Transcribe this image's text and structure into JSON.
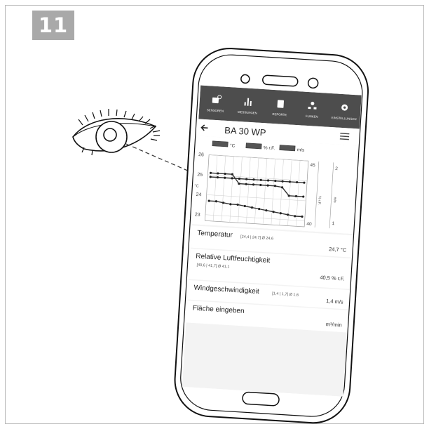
{
  "step_number": "11",
  "app": {
    "tabs": [
      {
        "label": "SENSOREN",
        "icon": "sensor-icon"
      },
      {
        "label": "MESSUNGEN",
        "icon": "bar-chart-icon"
      },
      {
        "label": "REPORTE",
        "icon": "document-icon"
      },
      {
        "label": "FUNKEN",
        "icon": "network-icon"
      },
      {
        "label": "EINSTELLUNGEN",
        "icon": "gear-icon"
      }
    ],
    "back_icon": "arrow-left-icon",
    "title": "BA 30 WP",
    "menu_icon": "hamburger-icon"
  },
  "chart_data": {
    "type": "line",
    "legend": [
      "°C",
      "% r.F.",
      "m/s"
    ],
    "left_axis": {
      "label": "°C",
      "ticks": [
        "26",
        "25",
        "24",
        "23"
      ],
      "range": [
        22.7,
        26
      ]
    },
    "right_axis_1": {
      "label": "% r.F.",
      "ticks": [
        "45",
        "40"
      ],
      "range": [
        39.7,
        45.3
      ]
    },
    "right_axis_2": {
      "label": "m/s",
      "ticks": [
        "2",
        "1"
      ],
      "range": [
        0.9,
        2.1
      ]
    },
    "series": [
      {
        "y": [
          25.1,
          25.1,
          25.1,
          25.1,
          24.65,
          24.65,
          24.65,
          24.65,
          24.65,
          24.65,
          24.6,
          24.2,
          24.2,
          24.2
        ]
      },
      {
        "y": [
          24.9,
          24.9,
          24.9,
          24.9,
          24.9,
          24.9,
          24.9,
          24.9,
          24.9,
          24.9,
          24.9,
          24.9,
          24.9,
          24.9
        ]
      },
      {
        "y": [
          23.7,
          23.7,
          23.65,
          23.6,
          23.6,
          23.55,
          23.5,
          23.45,
          23.4,
          23.35,
          23.3,
          23.25,
          23.2,
          23.2
        ]
      }
    ],
    "grid": true
  },
  "readings": [
    {
      "label": "Temperatur",
      "stats": "[24,4 | 24,7]  Ø 24,6",
      "value": "24,7 °C"
    },
    {
      "label": "Relative Luftfeuchtigkeit",
      "stats": "[40,6 | 41,7]  Ø 41,1",
      "value": "40,5 % r.F."
    },
    {
      "label": "Windgeschwindigkeit",
      "stats": "[1,4 | 1,7]  Ø 1,6",
      "value": "1,4 m/s"
    },
    {
      "label": "Fläche eingeben",
      "stats": "",
      "value": "m³/min"
    }
  ]
}
